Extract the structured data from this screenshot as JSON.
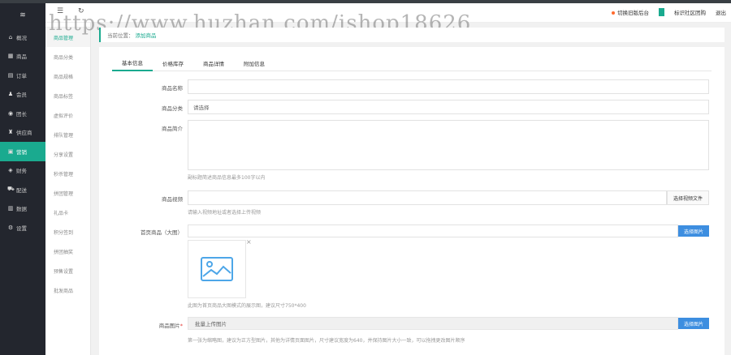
{
  "watermark": "https://www.huzhan.com/ishop18626",
  "topbar": {
    "menu_icon": "☰",
    "refresh_icon": "↻",
    "link1": "切换旧版后台",
    "link2": "标识社区团购",
    "logout": "退出"
  },
  "sidebar": {
    "logo": "≋",
    "items": [
      {
        "icon": "home-icon",
        "glyph": "⌂",
        "label": "概况"
      },
      {
        "icon": "goods-icon",
        "glyph": "▦",
        "label": "商品"
      },
      {
        "icon": "order-icon",
        "glyph": "▤",
        "label": "订单"
      },
      {
        "icon": "member-icon",
        "glyph": "♟",
        "label": "会员"
      },
      {
        "icon": "group-icon",
        "glyph": "◉",
        "label": "团长"
      },
      {
        "icon": "supplier-icon",
        "glyph": "♜",
        "label": "供应商"
      },
      {
        "icon": "marketing-icon",
        "glyph": "▣",
        "label": "营销"
      },
      {
        "icon": "finance-icon",
        "glyph": "◈",
        "label": "财务"
      },
      {
        "icon": "delivery-icon",
        "glyph": "⛟",
        "label": "配送"
      },
      {
        "icon": "data-icon",
        "glyph": "▥",
        "label": "数据"
      },
      {
        "icon": "settings-icon",
        "glyph": "⚙",
        "label": "设置"
      }
    ],
    "active_index": 6
  },
  "subnav": {
    "title": "秒杀管理",
    "items": [
      "商品管理",
      "商品分类",
      "商品规格",
      "商品标签",
      "虚拟评价",
      "排队管理",
      "分享设置",
      "秒杀管理",
      "拼团管理",
      "礼品卡",
      "积分签到",
      "拼团抽奖",
      "预售设置",
      "批发商品"
    ],
    "active_index": 0
  },
  "breadcrumb": {
    "prefix": "当前位置：",
    "current": "添加商品"
  },
  "tabs": [
    "基本信息",
    "价格库存",
    "商品详情",
    "附加信息"
  ],
  "form": {
    "name_label": "商品名称",
    "name_value": "",
    "category_label": "商品分类",
    "category_value": "请选择",
    "summary_label": "商品简介",
    "summary_hint": "副标题简述商品信息最多100字以内",
    "video_label": "商品视频",
    "video_button": "选择视频文件",
    "video_hint": "请输入视频地址或者选择上传视频",
    "cover_label": "首页商品（大图）",
    "cover_button": "选择图片",
    "cover_hint": "此图为首页商品大图模式的展示图，建议尺寸750*400",
    "gallery_label": "商品图片",
    "gallery_placeholder": "批量上传图片",
    "gallery_button": "选择图片",
    "gallery_hint": "第一张为缩略图，建议为正方型图片，其他为详情页面图片，尺寸建议宽度为640，并保持图片大小一致，可以拖拽更改图片顺序"
  },
  "colors": {
    "accent": "#1aaa8f",
    "button": "#3d8ee0",
    "sidebar": "#23262e"
  }
}
